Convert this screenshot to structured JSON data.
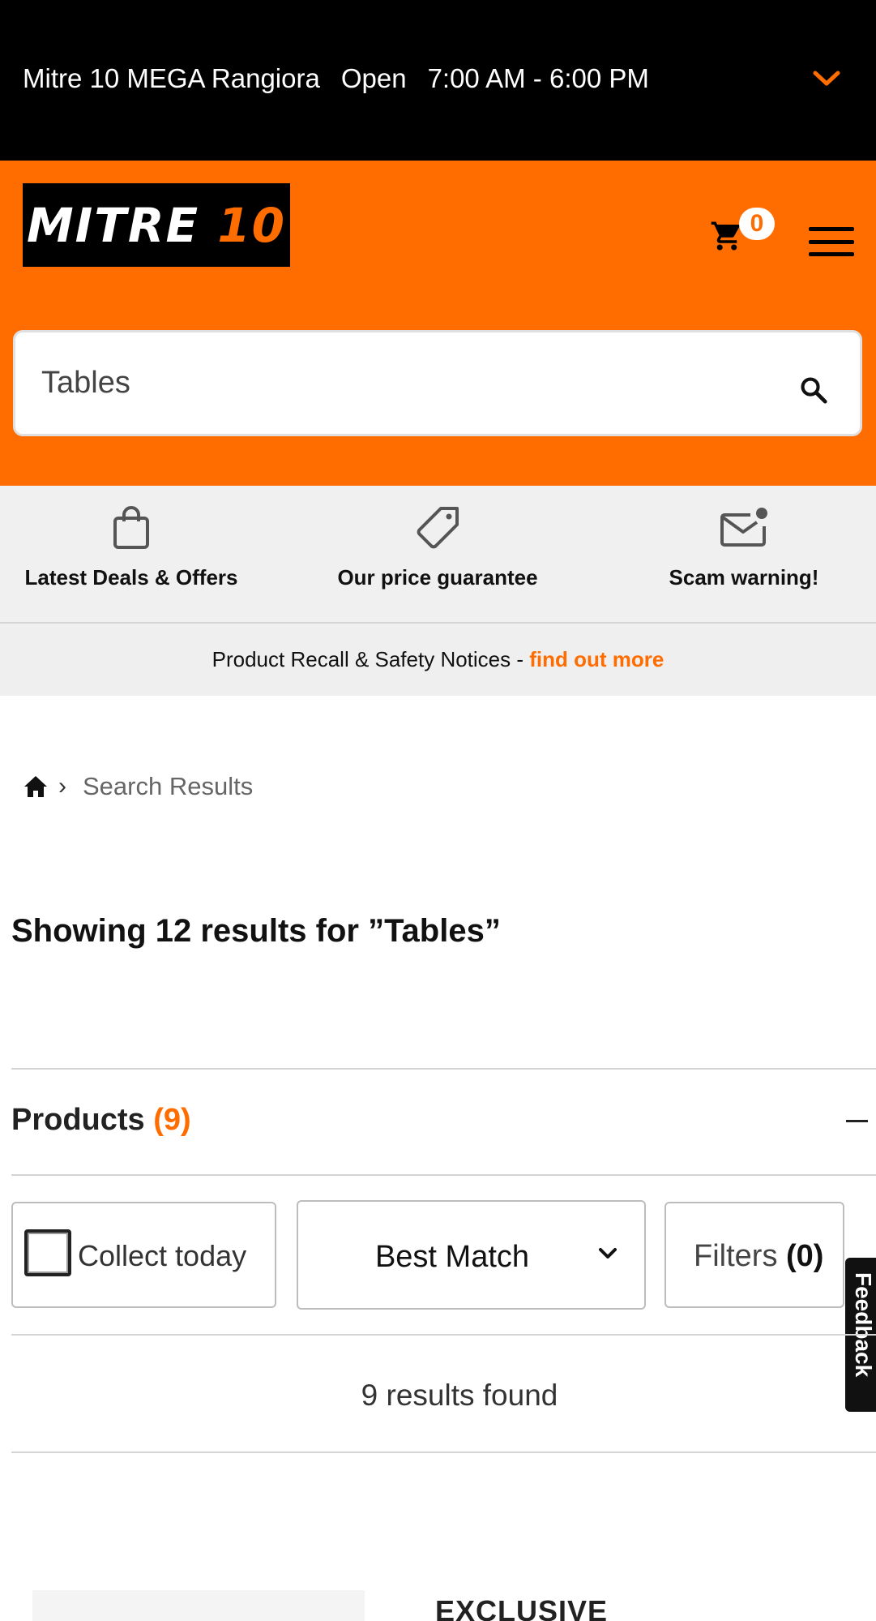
{
  "store_bar": {
    "store_name": "Mitre 10 MEGA Rangiora",
    "status": "Open",
    "hours": "7:00 AM - 6:00 PM"
  },
  "header": {
    "logo_word": "MITRE",
    "logo_number": "10",
    "cart_count": "0",
    "search_value": "Tables"
  },
  "info_bar": {
    "items": [
      {
        "label": "Latest Deals & Offers",
        "icon": "shopping-bag-icon"
      },
      {
        "label": "Our price guarantee",
        "icon": "price-tag-icon"
      },
      {
        "label": "Scam warning!",
        "icon": "mail-alert-icon"
      }
    ]
  },
  "recall": {
    "text": "Product Recall & Safety Notices - ",
    "link": "find out more"
  },
  "breadcrumb": {
    "current": "Search Results"
  },
  "results_title": "Showing 12 results for ”Tables”",
  "products": {
    "label": "Products",
    "count": "(9)"
  },
  "controls": {
    "collect_label": "Collect today",
    "sort_value": "Best Match",
    "filters_label": "Filters",
    "filters_count": "(0)"
  },
  "results_found": "9 results found",
  "feedback_label": "Feedback",
  "product_badge": "EXCLUSIVE",
  "colors": {
    "brand_orange": "#ff6c00",
    "black": "#000000"
  }
}
